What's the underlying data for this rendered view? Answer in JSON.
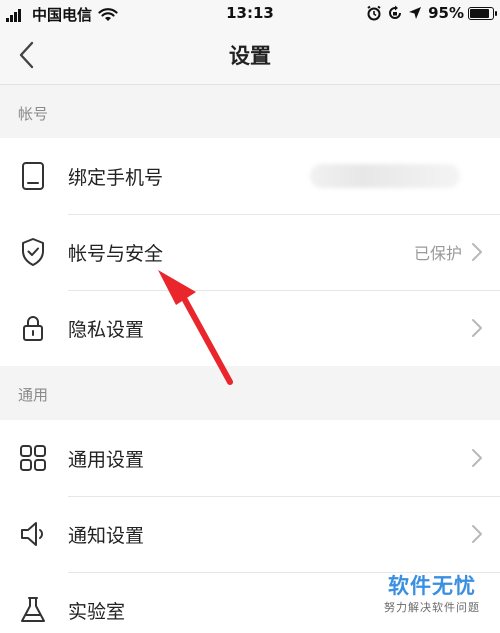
{
  "status_bar": {
    "carrier": "中国电信",
    "time": "13:13",
    "battery_percent": "95%",
    "battery_level": 0.95
  },
  "nav": {
    "title": "设置"
  },
  "sections": {
    "account": {
      "header": "帐号",
      "items": [
        {
          "label": "绑定手机号",
          "value": "",
          "icon": "phone-icon"
        },
        {
          "label": "帐号与安全",
          "value": "已保护",
          "icon": "shield-icon"
        },
        {
          "label": "隐私设置",
          "value": "",
          "icon": "lock-icon"
        }
      ]
    },
    "general": {
      "header": "通用",
      "items": [
        {
          "label": "通用设置",
          "value": "",
          "icon": "grid-icon"
        },
        {
          "label": "通知设置",
          "value": "",
          "icon": "speaker-icon"
        },
        {
          "label": "实验室",
          "value": "",
          "icon": "flask-icon"
        }
      ]
    }
  },
  "watermark": {
    "main": "软件无忧",
    "sub": "努力解决软件问题"
  },
  "colors": {
    "annotation_arrow": "#e8262b",
    "watermark_blue": "#3a8fe0"
  }
}
